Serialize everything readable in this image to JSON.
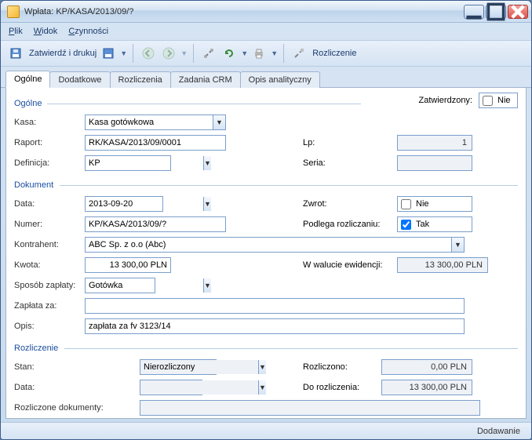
{
  "window": {
    "title": "Wpłata: KP/KASA/2013/09/?"
  },
  "menu": {
    "plik": "Plik",
    "widok": "Widok",
    "czynnosci": "Czynności"
  },
  "toolbar": {
    "zatwierdz": "Zatwierdź i drukuj",
    "rozliczenie": "Rozliczenie"
  },
  "tabs": {
    "ogolne": "Ogólne",
    "dodatkowe": "Dodatkowe",
    "rozliczenia": "Rozliczenia",
    "zadania": "Zadania CRM",
    "opis": "Opis analityczny"
  },
  "section": {
    "ogolne_title": "Ogólne",
    "zatwierdzony_lbl": "Zatwierdzony:",
    "zatwierdzony_val": "Nie",
    "kasa_lbl": "Kasa:",
    "kasa_val": "Kasa gotówkowa",
    "raport_lbl": "Raport:",
    "raport_val": "RK/KASA/2013/09/0001",
    "lp_lbl": "Lp:",
    "lp_val": "1",
    "definicja_lbl": "Definicja:",
    "definicja_val": "KP",
    "seria_lbl": "Seria:",
    "seria_val": "",
    "dokument_title": "Dokument",
    "data_lbl": "Data:",
    "data_val": "2013-09-20",
    "zwrot_lbl": "Zwrot:",
    "zwrot_val": "Nie",
    "numer_lbl": "Numer:",
    "numer_val": "KP/KASA/2013/09/?",
    "podlega_lbl": "Podlega rozliczaniu:",
    "podlega_val": "Tak",
    "kontrahent_lbl": "Kontrahent:",
    "kontrahent_val": "ABC Sp. z o.o (Abc)",
    "kwota_lbl": "Kwota:",
    "kwota_val": "13 300,00 PLN",
    "wwalucie_lbl": "W walucie ewidencji:",
    "wwalucie_val": "13 300,00 PLN",
    "sposob_lbl": "Sposób zapłaty:",
    "sposob_val": "Gotówka",
    "zaplata_lbl": "Zapłata za:",
    "zaplata_val": "",
    "opis_lbl": "Opis:",
    "opis_val": "zapłata za fv 3123/14",
    "rozliczenie_title": "Rozliczenie",
    "stan_lbl": "Stan:",
    "stan_val": "Nierozliczony",
    "rozliczono_lbl": "Rozliczono:",
    "rozliczono_val": "0,00 PLN",
    "rdata_lbl": "Data:",
    "rdata_val": "",
    "dorozl_lbl": "Do rozliczenia:",
    "dorozl_val": "13 300,00 PLN",
    "rozldok_lbl": "Rozliczone dokumenty:",
    "rozldok_val": ""
  },
  "status": {
    "mode": "Dodawanie"
  }
}
